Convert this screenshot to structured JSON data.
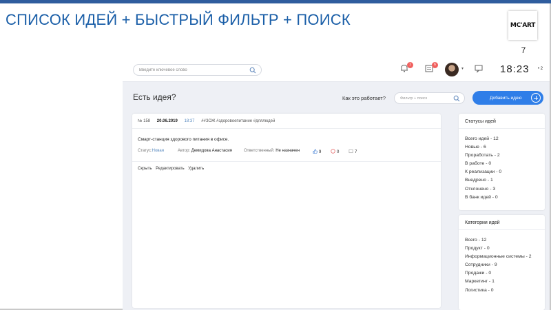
{
  "slide": {
    "title": "СПИСОК ИДЕЙ + БЫСТРЫЙ ФИЛЬТР + ПОИСК",
    "logo": "MC'ART",
    "page_number": "7"
  },
  "header": {
    "search_placeholder": "Введите ключевое слово",
    "notifications_badge": "1",
    "tasks_badge": "6",
    "time": "18:23",
    "time_extra": "2"
  },
  "toolbar": {
    "page_title": "Есть идея?",
    "how_it_works": "Как это работает?",
    "filter_placeholder": "Фильтр + поиск",
    "add_button": "Добавить идею"
  },
  "idea": {
    "number": "№ 158",
    "date": "20.06.2019",
    "time": "18:37",
    "tags": "##ЗОЖ #здоровоепитание #длялюдей",
    "title": "Смарт-станция здорового питания в офисе.",
    "status_label": "Статус:",
    "status_value": "Новая",
    "author_label": "Автор:",
    "author_value": "Демидова Анастасия",
    "responsible_label": "Ответственный:",
    "responsible_value": "Не назначен",
    "likes": "9",
    "dislikes": "0",
    "comments": "7",
    "actions": [
      "Скрыть",
      "Редактировать",
      "Удалить"
    ]
  },
  "statuses": {
    "title": "Статусы идей",
    "items": [
      "Всего идей - 12",
      "Новые - 6",
      "Проработать - 2",
      "В работе - 0",
      "К реализации - 0",
      "Внедрено - 1",
      "Отклонено - 3",
      "В банк идей - 0"
    ]
  },
  "categories": {
    "title": "Категории идей",
    "items": [
      "Всего - 12",
      "Продукт - 0",
      "Информационные системы - 2",
      "Сотрудники - 9",
      "Продажи - 0",
      "Маркетинг - 1",
      "Логистика - 0"
    ]
  },
  "colors": {
    "accent": "#2f7ee8",
    "title_blue": "#1b5fa8",
    "badge_red": "#f0605e"
  }
}
